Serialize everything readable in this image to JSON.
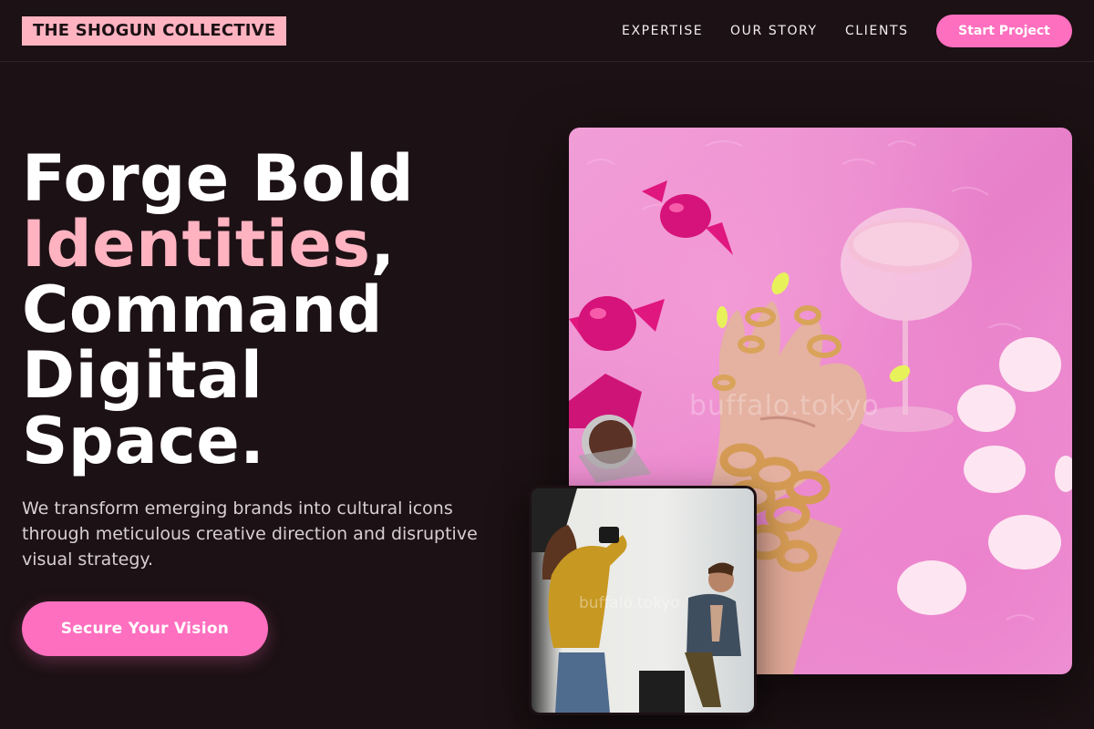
{
  "header": {
    "logo": "THE SHOGUN COLLECTIVE",
    "nav": [
      {
        "label": "EXPERTISE"
      },
      {
        "label": "OUR STORY"
      },
      {
        "label": "CLIENTS"
      }
    ],
    "start_button": "Start Project"
  },
  "hero": {
    "headline_line1": "Forge Bold",
    "headline_accent": "Identities",
    "headline_comma": ",",
    "headline_line3": "Command",
    "headline_line4": "Digital",
    "headline_line5": "Space.",
    "subtext": "We transform emerging brands into cultural icons through meticulous creative direction and disruptive visual strategy.",
    "cta": "Secure Your Vision"
  },
  "images": {
    "main_watermark": "buffalo.tokyo",
    "inset_watermark": "buffalo.tokyo"
  },
  "colors": {
    "background": "#1c1114",
    "accent_pink": "#ff6fbf",
    "soft_pink": "#ffb3c1"
  }
}
